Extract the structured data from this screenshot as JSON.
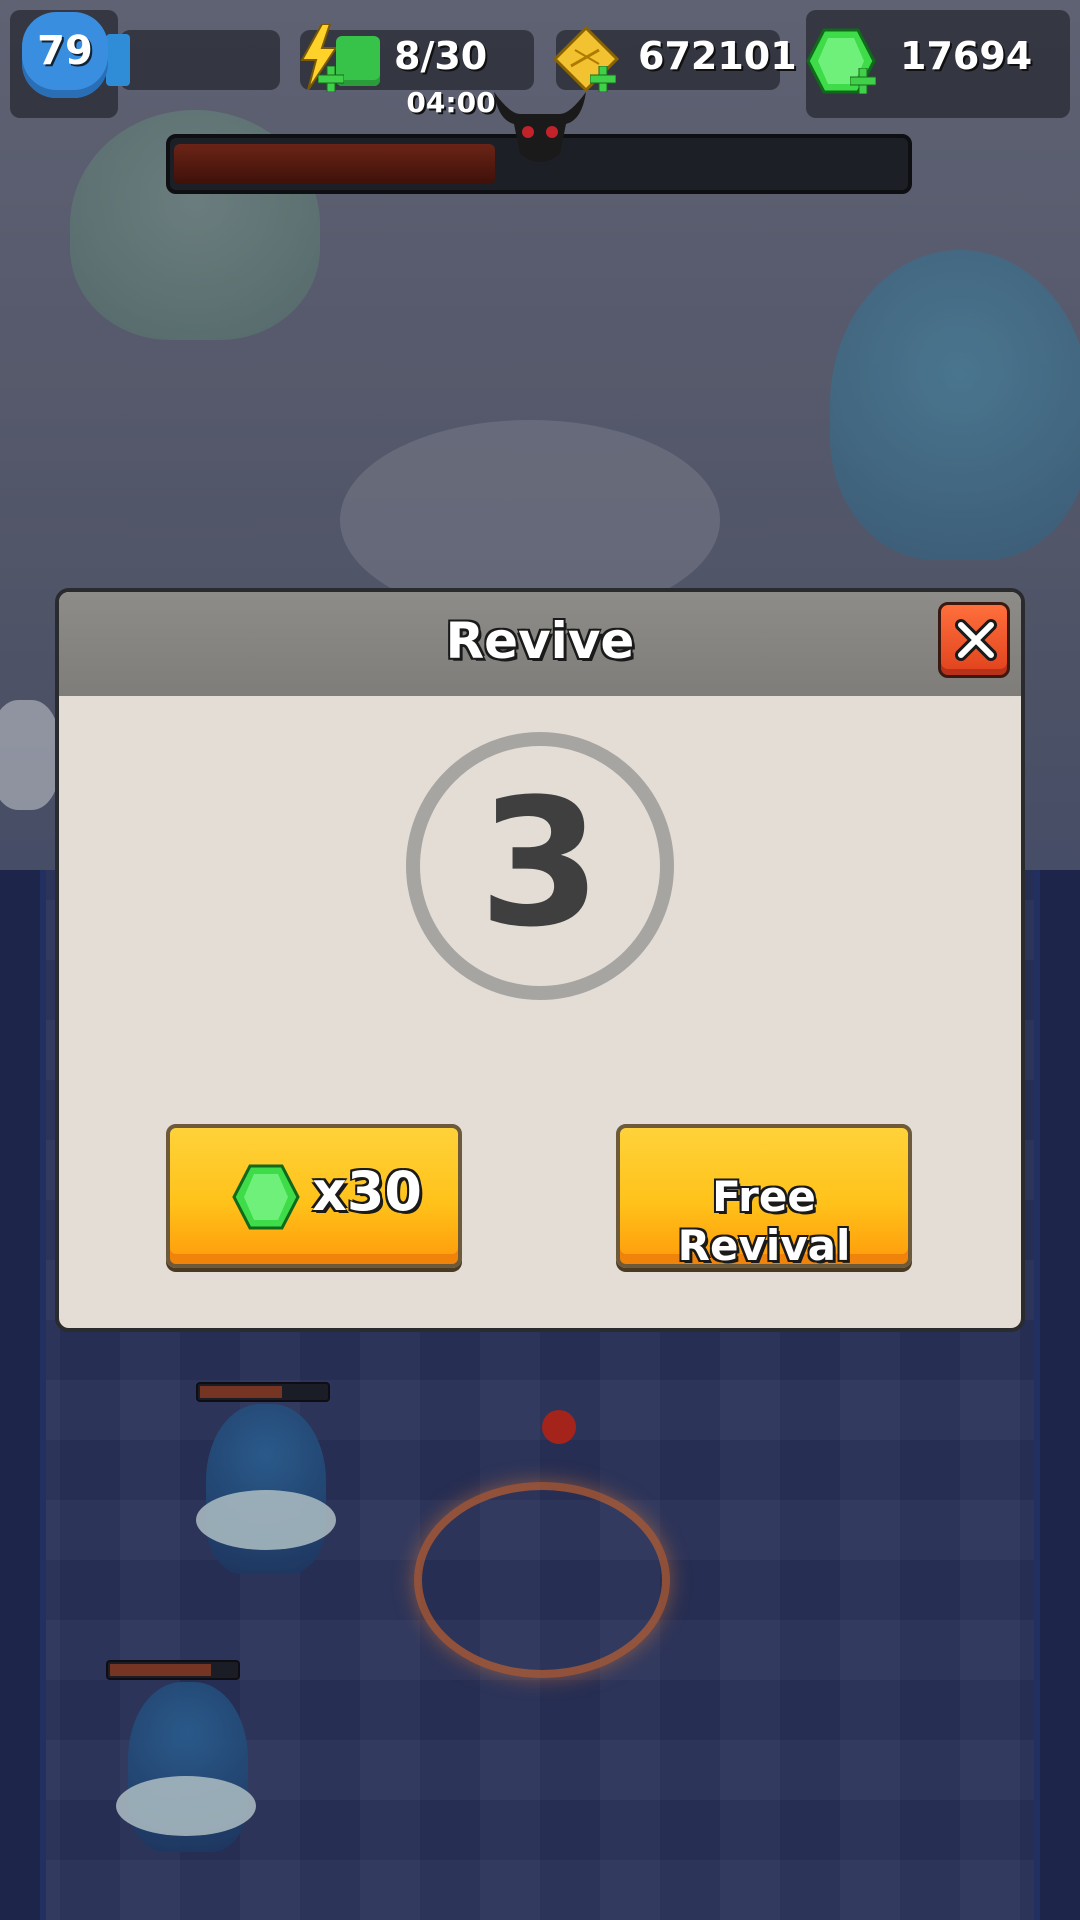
{
  "hud": {
    "level": "79",
    "energy": "8/30",
    "energy_timer": "04:00",
    "gold": "672101",
    "gems": "17694"
  },
  "boss": {
    "health_fraction": 0.44
  },
  "dialog": {
    "title": "Revive",
    "countdown": "3",
    "gem_button_label": "x30",
    "free_button_label": "Free Revival"
  },
  "enemies": [
    {
      "health_fraction": 0.65
    },
    {
      "health_fraction": 0.8
    }
  ],
  "colors": {
    "button_yellow": "#ffc21a",
    "close_red": "#e0421c",
    "gem_green": "#3ddc48",
    "gold": "#f2c230",
    "level_blue": "#3a8ee0"
  }
}
